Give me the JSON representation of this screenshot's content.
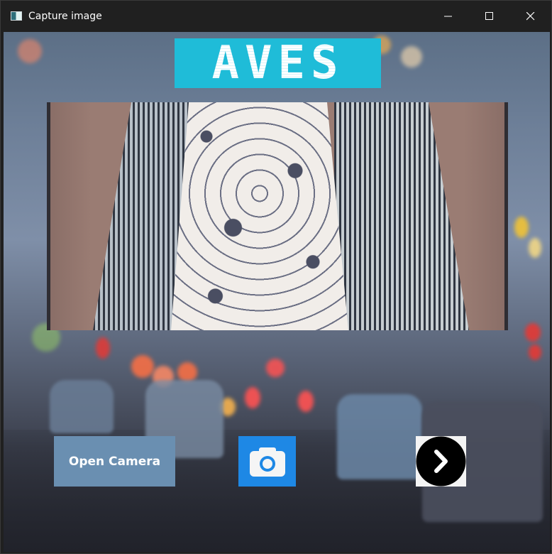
{
  "window": {
    "title": "Capture image",
    "controls": {
      "minimize_icon": "minimize-icon",
      "maximize_icon": "maximize-icon",
      "close_icon": "close-icon"
    }
  },
  "header": {
    "logo_text": "AVES",
    "logo_color": "#1fbcd8"
  },
  "preview": {
    "label": ""
  },
  "actions": {
    "open_camera_label": "Open Camera",
    "open_camera_color": "#6a8fb1",
    "capture_icon": "camera-icon",
    "capture_color": "#1e88e5",
    "next_icon": "chevron-right-icon"
  }
}
